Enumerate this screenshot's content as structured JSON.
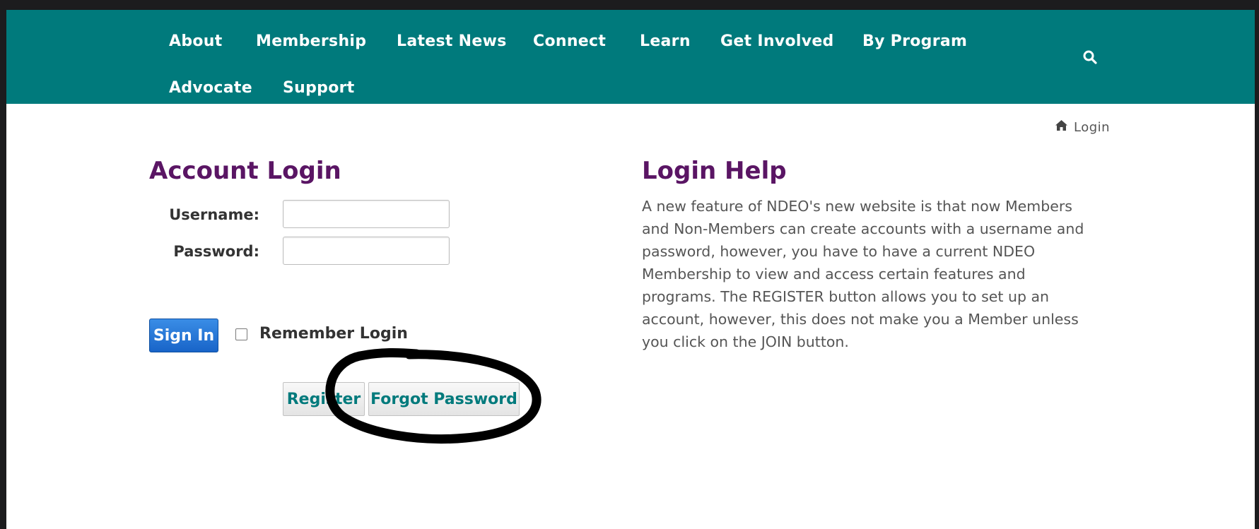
{
  "nav": {
    "items": [
      {
        "label": "About"
      },
      {
        "label": "Membership"
      },
      {
        "label": "Latest News"
      },
      {
        "label": "Connect"
      },
      {
        "label": "Learn"
      },
      {
        "label": "Get Involved"
      },
      {
        "label": "By Program"
      },
      {
        "label": "Advocate"
      },
      {
        "label": "Support"
      }
    ],
    "search_icon": "search-icon",
    "background_color": "#007a7c"
  },
  "breadcrumb": {
    "icon": "home-icon",
    "current": "Login"
  },
  "login": {
    "title": "Account Login",
    "username_label": "Username:",
    "username_value": "",
    "password_label": "Password:",
    "password_value": "",
    "signin_label": "Sign In",
    "remember_label": "Remember Login",
    "remember_checked": false,
    "register_label": "Register",
    "forgot_label": "Forgot Password"
  },
  "help": {
    "title": "Login Help",
    "body": "A new feature of NDEO's new website is that now Members and Non-Members can create accounts with a username and password, however, you have to have a current NDEO Membership to view and access certain features and programs. The REGISTER button allows you to set up an account, however, this does not make you a Member unless you click on the JOIN button."
  },
  "colors": {
    "heading": "#5a1564",
    "accent_teal": "#007a7c",
    "signin_blue": "#1864c8"
  }
}
